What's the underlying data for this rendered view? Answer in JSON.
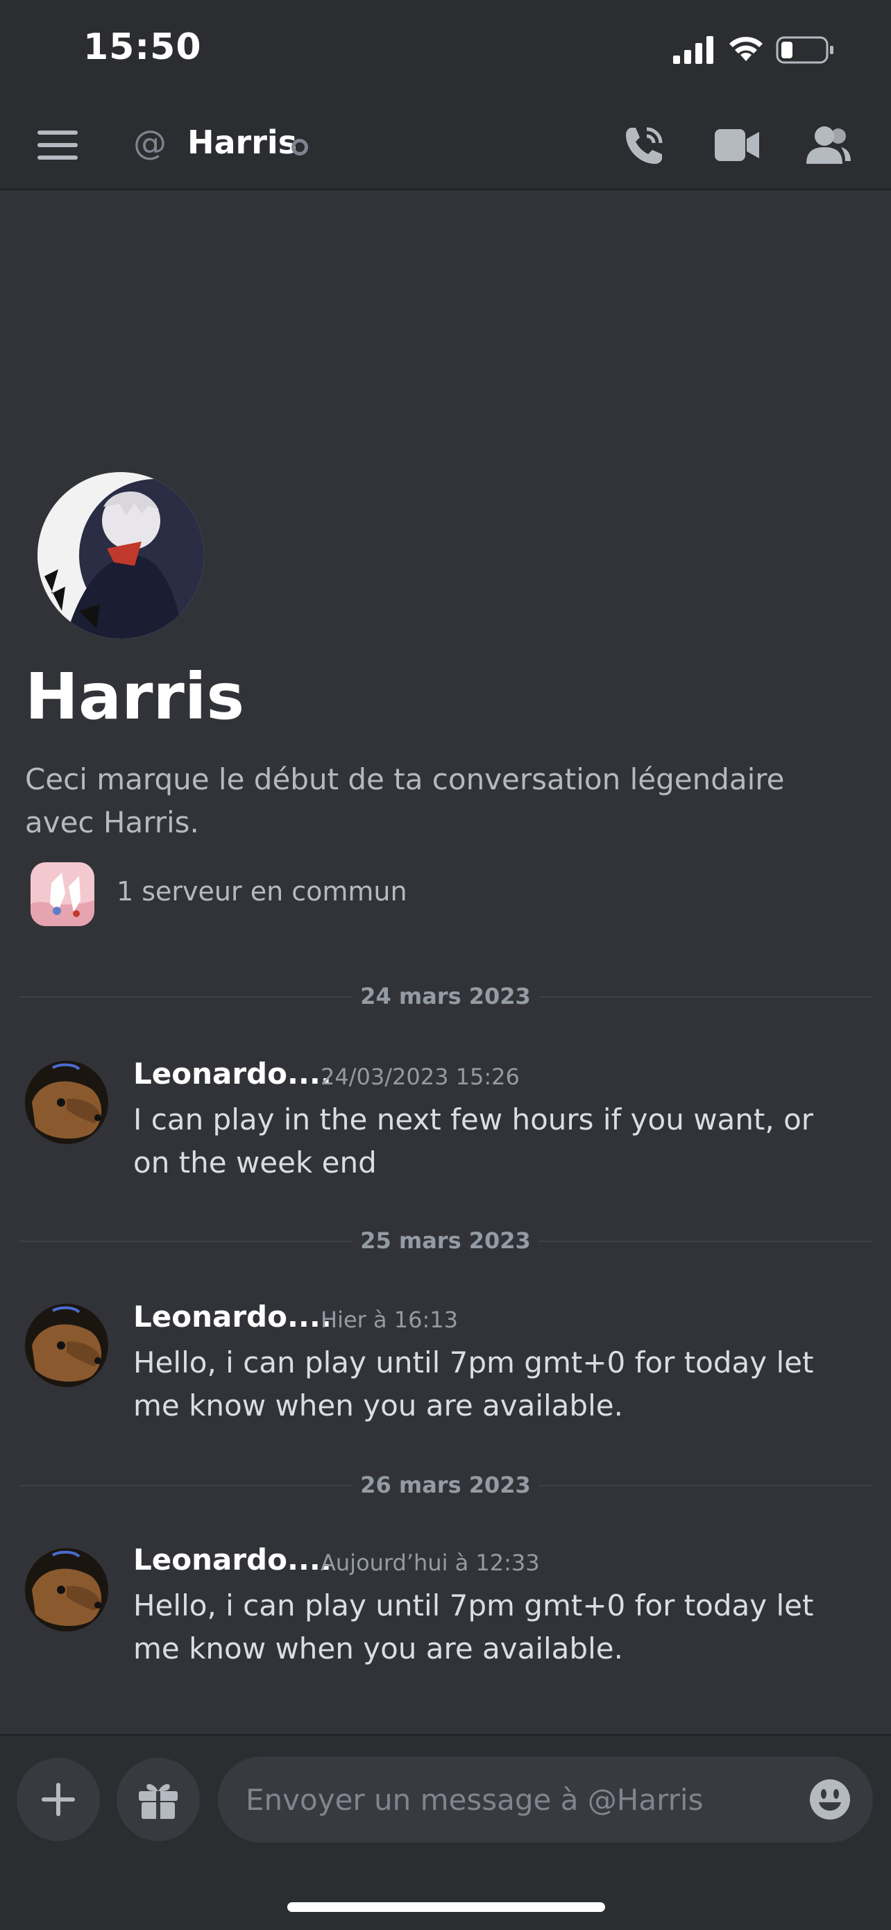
{
  "status_bar": {
    "time": "15:50"
  },
  "header": {
    "at_symbol": "@",
    "title": "Harris"
  },
  "intro": {
    "name": "Harris",
    "description": "Ceci marque le début de ta conversation légendaire avec Harris.",
    "servers_in_common": "1 serveur en commun"
  },
  "messages": [
    {
      "date_divider": "24 mars 2023",
      "author": "Leonardo....",
      "timestamp": "24/03/2023 15:26",
      "text": "I can play in the next few hours if you want, or on the week end"
    },
    {
      "date_divider": "25 mars 2023",
      "author": "Leonardo....",
      "timestamp": "Hier à 16:13",
      "text": "Hello, i can play until 7pm gmt+0 for today let me know when you are available."
    },
    {
      "date_divider": "26 mars 2023",
      "author": "Leonardo....",
      "timestamp": "Aujourd’hui à 12:33",
      "text": "Hello, i can play until 7pm gmt+0 for today let me know when you are available."
    }
  ],
  "composer": {
    "placeholder": "Envoyer un message à @Harris"
  },
  "colors": {
    "background": "#313338",
    "header_background": "#2b2d31",
    "muted_text": "#949ba4",
    "offline_status": "#80848e"
  },
  "icons": {
    "menu": "hamburger-icon",
    "at": "at-icon",
    "call": "phone-call-icon",
    "video": "video-camera-icon",
    "members": "members-icon",
    "add": "plus-icon",
    "gift": "gift-icon",
    "emoji": "emoji-icon"
  }
}
